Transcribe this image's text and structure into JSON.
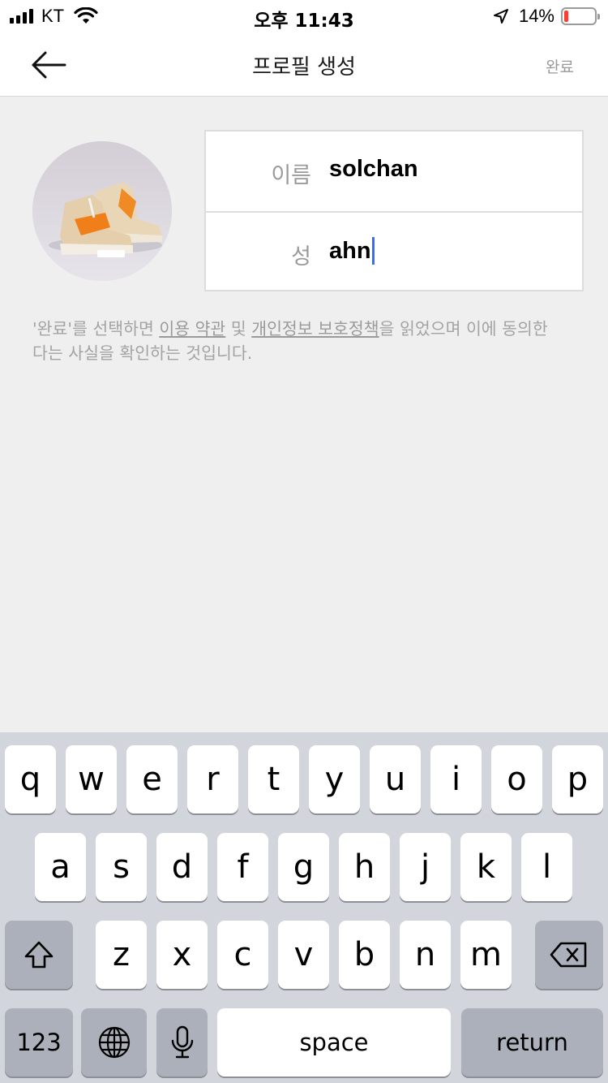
{
  "status_bar": {
    "carrier": "KT",
    "time": "오후 11:43",
    "battery_percent": "14%",
    "battery_level": 0.14,
    "battery_color": "#ff3b30"
  },
  "header": {
    "back_icon": "arrow-left-icon",
    "title": "프로필 생성",
    "done_label": "완료"
  },
  "profile": {
    "avatar_alt": "profile photo (sneakers)",
    "fields": [
      {
        "label": "이름",
        "value": "solchan"
      },
      {
        "label": "성",
        "value": "ahn"
      }
    ],
    "cursor_color": "#3d6cf2"
  },
  "terms": {
    "prefix": "'완료'를 선택하면 ",
    "terms_link": "이용 약관",
    "middle": " 및 ",
    "privacy_link": "개인정보 보호정책",
    "suffix": "을 읽었으며 이에 동의한다는 사실을 확인하는 것입니다."
  },
  "keyboard": {
    "row1": [
      "q",
      "w",
      "e",
      "r",
      "t",
      "y",
      "u",
      "i",
      "o",
      "p"
    ],
    "row2": [
      "a",
      "s",
      "d",
      "f",
      "g",
      "h",
      "j",
      "k",
      "l"
    ],
    "row3": [
      "z",
      "x",
      "c",
      "v",
      "b",
      "n",
      "m"
    ],
    "shift_icon": "shift-icon",
    "delete_icon": "backspace-icon",
    "numbers_label": "123",
    "globe_icon": "globe-icon",
    "mic_icon": "microphone-icon",
    "space_label": "space",
    "return_label": "return"
  }
}
